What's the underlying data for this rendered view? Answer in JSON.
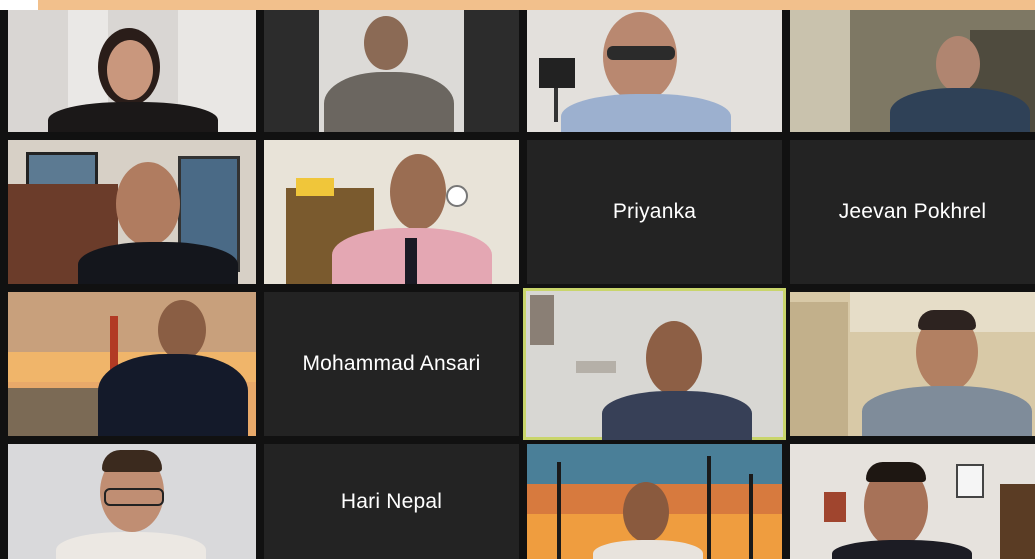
{
  "meeting": {
    "accent_color": "#f2c08c",
    "active_speaker_border": "#c9d56b",
    "participants": [
      {
        "name": "Priyanka",
        "video": false
      },
      {
        "name": "Jeevan Pokhrel",
        "video": false
      },
      {
        "name": "Mohammad Ansari",
        "video": false
      },
      {
        "name": "Hari Nepal",
        "video": false
      }
    ]
  }
}
